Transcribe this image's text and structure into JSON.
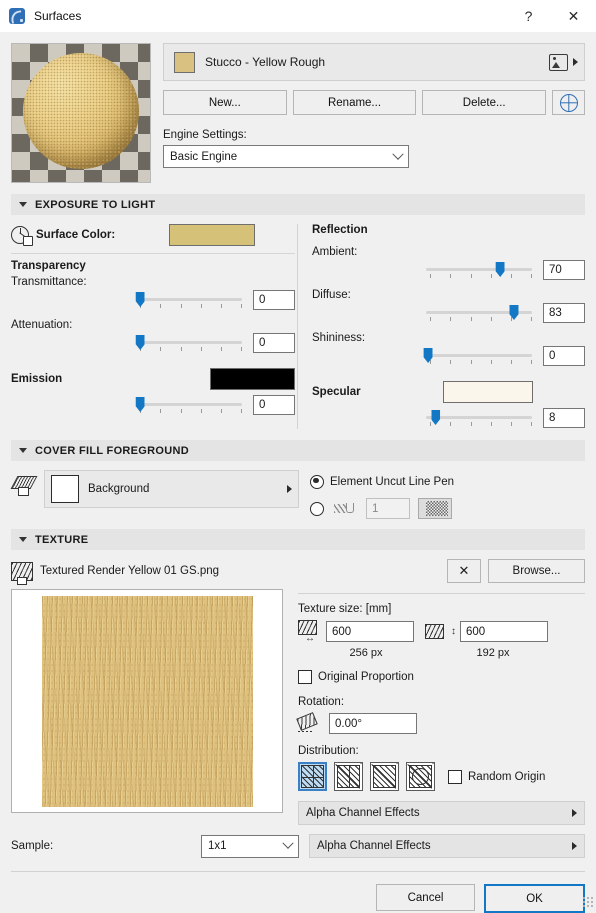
{
  "window": {
    "title": "Surfaces",
    "help_label": "?",
    "close_label": "✕"
  },
  "material": {
    "name": "Stucco - Yellow Rough",
    "swatch_color": "#d9c281",
    "preview_icon": "sphere-preview"
  },
  "buttons": {
    "new": "New...",
    "rename": "Rename...",
    "delete": "Delete...",
    "globe_icon": "globe-icon"
  },
  "engine": {
    "label": "Engine Settings:",
    "value": "Basic Engine"
  },
  "exposure": {
    "header": "EXPOSURE TO LIGHT",
    "surface_color_label": "Surface Color:",
    "surface_color_value": "#d6c178",
    "transparency_label": "Transparency",
    "transmittance_label": "Transmittance:",
    "transmittance_value": "0",
    "transmittance_pct": 4,
    "attenuation_label": "Attenuation:",
    "attenuation_value": "0",
    "attenuation_pct": 4,
    "emission_label": "Emission",
    "emission_color": "#000000",
    "emission_value": "0",
    "emission_pct": 4,
    "reflection_label": "Reflection",
    "ambient_label": "Ambient:",
    "ambient_value": "70",
    "ambient_pct": 70,
    "diffuse_label": "Diffuse:",
    "diffuse_value": "83",
    "diffuse_pct": 83,
    "shininess_label": "Shininess:",
    "shininess_value": "0",
    "shininess_pct": 2,
    "specular_label": "Specular",
    "specular_color": "#fbf6ec",
    "specular_value": "8",
    "specular_pct": 9
  },
  "cover_fill": {
    "header": "COVER FILL FOREGROUND",
    "fill_name": "Background",
    "fill_color": "#ffffff",
    "radio_element_pen": "Element Uncut Line Pen",
    "radio_element_pen_selected": true,
    "pen_number": "1",
    "pen_icon": "pen-line-icon",
    "pattern_icon": "pattern-swatch"
  },
  "texture": {
    "header": "TEXTURE",
    "file_name": "Textured Render Yellow 01 GS.png",
    "clear_label": "✕",
    "browse_label": "Browse...",
    "preview_color": "#dfc17e",
    "size_label": "Texture size: [mm]",
    "width_value": "600",
    "width_px": "256 px",
    "height_value": "600",
    "height_px": "192 px",
    "original_proportion_label": "Original Proportion",
    "original_proportion_checked": false,
    "rotation_label": "Rotation:",
    "rotation_value": "0.00°",
    "distribution_label": "Distribution:",
    "distribution_options": [
      "box-distribution",
      "fan-distribution",
      "cross-distribution",
      "radial-distribution"
    ],
    "distribution_selected": 0,
    "random_origin_label": "Random Origin",
    "random_origin_checked": false,
    "alpha_channel_label": "Alpha Channel Effects"
  },
  "bottom": {
    "sample_label": "Sample:",
    "sample_value": "1x1",
    "alpha_channel_label": "Alpha Channel Effects",
    "cancel": "Cancel",
    "ok": "OK"
  }
}
